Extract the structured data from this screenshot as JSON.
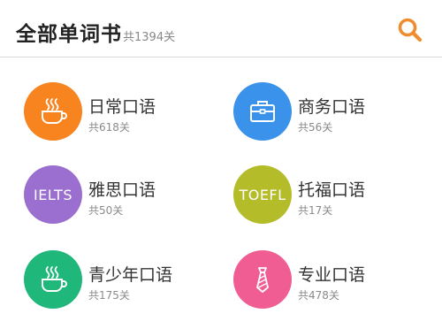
{
  "header": {
    "title": "全部单词书",
    "count": "共1394关",
    "search_icon": "search-icon",
    "accent": "#f08c2e"
  },
  "books": [
    {
      "name": "日常口语",
      "count": "共618关",
      "color": "#f7841f",
      "icon": "coffee-cup-icon"
    },
    {
      "name": "商务口语",
      "count": "共56关",
      "color": "#3b92ea",
      "icon": "briefcase-icon"
    },
    {
      "name": "雅思口语",
      "count": "共50关",
      "color": "#9b6fd0",
      "icon": "ielts-text-icon",
      "icon_text": "IELTS"
    },
    {
      "name": "托福口语",
      "count": "共17关",
      "color": "#b4bc2a",
      "icon": "toefl-text-icon",
      "icon_text": "TOEFL"
    },
    {
      "name": "青少年口语",
      "count": "共175关",
      "color": "#1fb77a",
      "icon": "coffee-cup-icon"
    },
    {
      "name": "专业口语",
      "count": "共478关",
      "color": "#ef5d93",
      "icon": "necktie-icon"
    }
  ]
}
